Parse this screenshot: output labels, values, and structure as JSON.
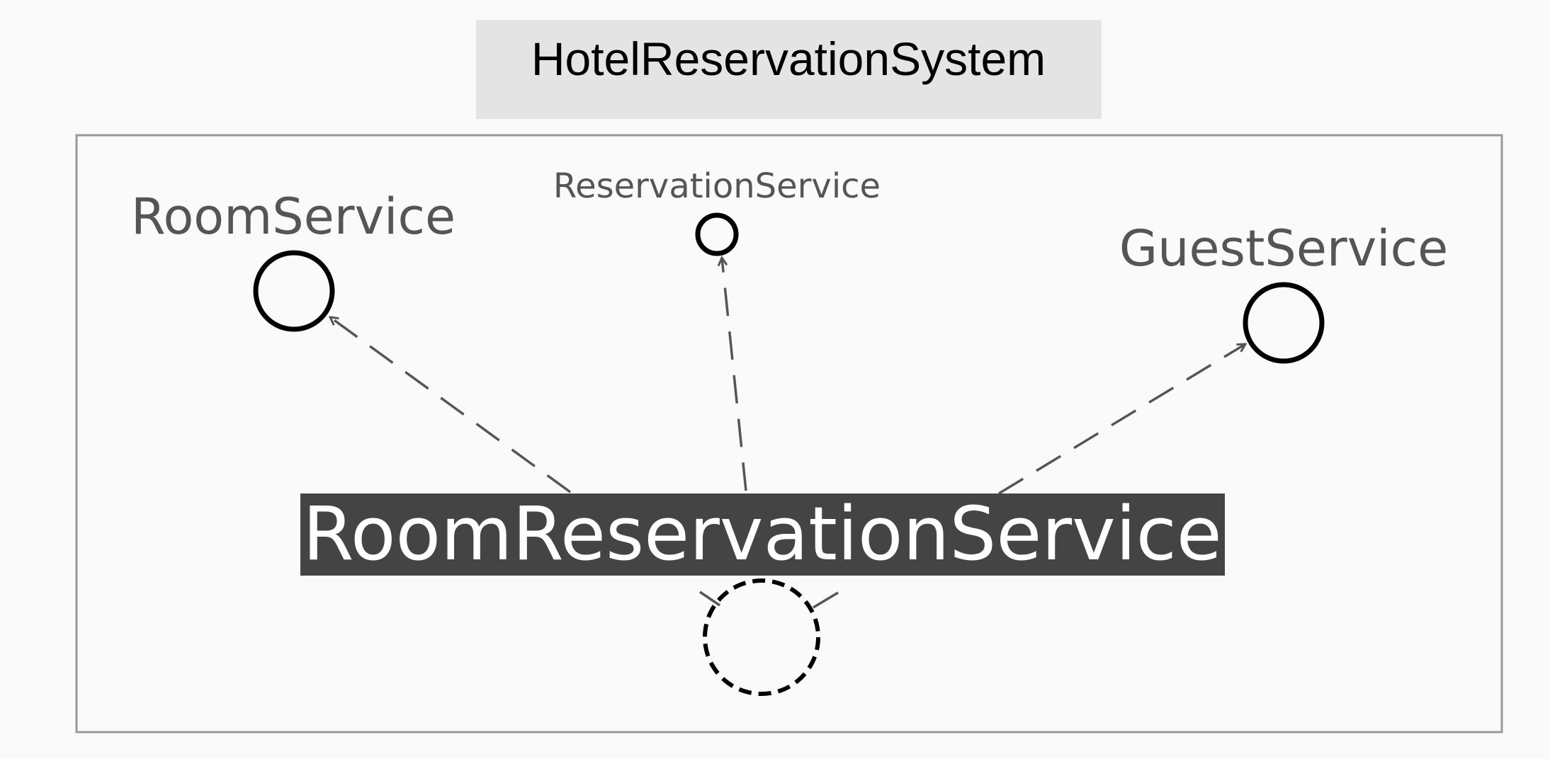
{
  "diagram": {
    "title": "HotelReservationSystem",
    "component": "RoomReservationService",
    "interfaces": {
      "room": "RoomService",
      "reservation": "ReservationService",
      "guest": "GuestService"
    }
  },
  "colors": {
    "background": "#fafafa",
    "title_box": "#e4e4e4",
    "frame": "#999999",
    "component_fill": "#444444",
    "component_text": "#ffffff",
    "interface_label": "#555555",
    "dependency_line": "#555555",
    "interface_circle": "#000000"
  }
}
